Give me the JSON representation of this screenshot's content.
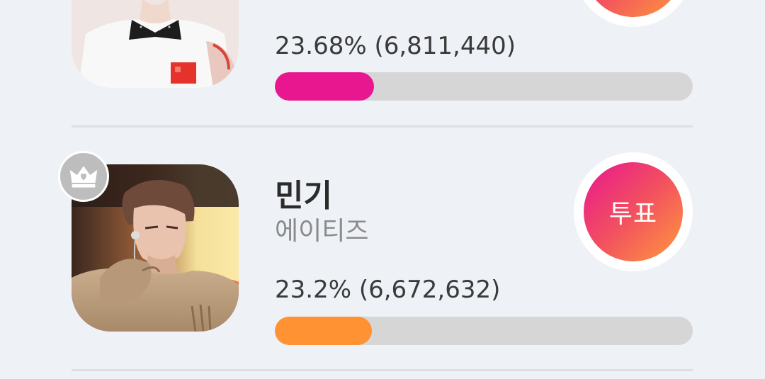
{
  "entries": [
    {
      "stat_text": "23.68% (6,811,440)",
      "vote_share_percent": 23.68,
      "bar_color": "#e8178f",
      "vote_label": "투표"
    },
    {
      "name": "민기",
      "group": "에이티즈",
      "stat_text": "23.2% (6,672,632)",
      "vote_share_percent": 23.2,
      "bar_color": "#ff9233",
      "vote_label": "투표",
      "badge_icon": "crown-icon"
    }
  ],
  "colors": {
    "background": "#eef1f6",
    "track": "#d6d6d6",
    "vote_gradient_start": "#e8178f",
    "vote_gradient_end": "#ff9a3c"
  }
}
